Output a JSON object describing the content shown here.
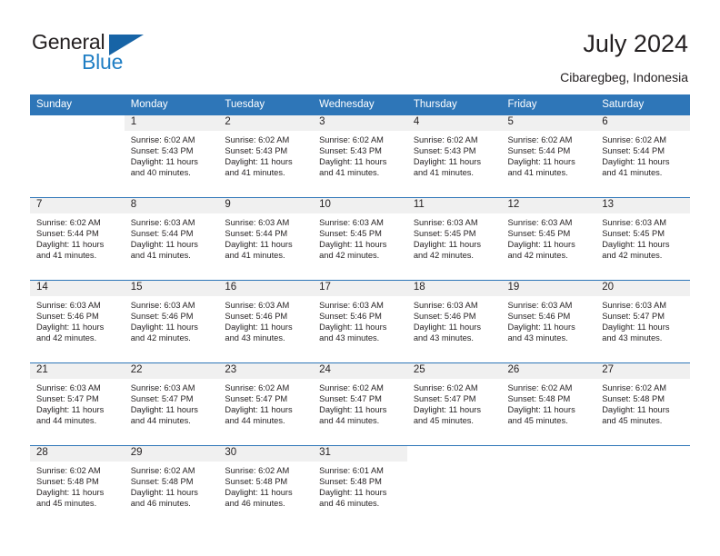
{
  "brand": {
    "name_top": "General",
    "name_bottom": "Blue",
    "accent_color": "#1f7ec4",
    "triangle_color": "#1764a6"
  },
  "header": {
    "title": "July 2024",
    "subtitle": "Cibaregbeg, Indonesia",
    "header_band_color": "#2e76b8",
    "daynum_band_color": "#f0f0f0"
  },
  "calendar": {
    "weekday_headers": [
      "Sunday",
      "Monday",
      "Tuesday",
      "Wednesday",
      "Thursday",
      "Friday",
      "Saturday"
    ],
    "weeks": [
      [
        {
          "day": "",
          "sunrise": "",
          "sunset": "",
          "daylight_line1": "",
          "daylight_line2": ""
        },
        {
          "day": "1",
          "sunrise": "Sunrise: 6:02 AM",
          "sunset": "Sunset: 5:43 PM",
          "daylight_line1": "Daylight: 11 hours",
          "daylight_line2": "and 40 minutes."
        },
        {
          "day": "2",
          "sunrise": "Sunrise: 6:02 AM",
          "sunset": "Sunset: 5:43 PM",
          "daylight_line1": "Daylight: 11 hours",
          "daylight_line2": "and 41 minutes."
        },
        {
          "day": "3",
          "sunrise": "Sunrise: 6:02 AM",
          "sunset": "Sunset: 5:43 PM",
          "daylight_line1": "Daylight: 11 hours",
          "daylight_line2": "and 41 minutes."
        },
        {
          "day": "4",
          "sunrise": "Sunrise: 6:02 AM",
          "sunset": "Sunset: 5:43 PM",
          "daylight_line1": "Daylight: 11 hours",
          "daylight_line2": "and 41 minutes."
        },
        {
          "day": "5",
          "sunrise": "Sunrise: 6:02 AM",
          "sunset": "Sunset: 5:44 PM",
          "daylight_line1": "Daylight: 11 hours",
          "daylight_line2": "and 41 minutes."
        },
        {
          "day": "6",
          "sunrise": "Sunrise: 6:02 AM",
          "sunset": "Sunset: 5:44 PM",
          "daylight_line1": "Daylight: 11 hours",
          "daylight_line2": "and 41 minutes."
        }
      ],
      [
        {
          "day": "7",
          "sunrise": "Sunrise: 6:02 AM",
          "sunset": "Sunset: 5:44 PM",
          "daylight_line1": "Daylight: 11 hours",
          "daylight_line2": "and 41 minutes."
        },
        {
          "day": "8",
          "sunrise": "Sunrise: 6:03 AM",
          "sunset": "Sunset: 5:44 PM",
          "daylight_line1": "Daylight: 11 hours",
          "daylight_line2": "and 41 minutes."
        },
        {
          "day": "9",
          "sunrise": "Sunrise: 6:03 AM",
          "sunset": "Sunset: 5:44 PM",
          "daylight_line1": "Daylight: 11 hours",
          "daylight_line2": "and 41 minutes."
        },
        {
          "day": "10",
          "sunrise": "Sunrise: 6:03 AM",
          "sunset": "Sunset: 5:45 PM",
          "daylight_line1": "Daylight: 11 hours",
          "daylight_line2": "and 42 minutes."
        },
        {
          "day": "11",
          "sunrise": "Sunrise: 6:03 AM",
          "sunset": "Sunset: 5:45 PM",
          "daylight_line1": "Daylight: 11 hours",
          "daylight_line2": "and 42 minutes."
        },
        {
          "day": "12",
          "sunrise": "Sunrise: 6:03 AM",
          "sunset": "Sunset: 5:45 PM",
          "daylight_line1": "Daylight: 11 hours",
          "daylight_line2": "and 42 minutes."
        },
        {
          "day": "13",
          "sunrise": "Sunrise: 6:03 AM",
          "sunset": "Sunset: 5:45 PM",
          "daylight_line1": "Daylight: 11 hours",
          "daylight_line2": "and 42 minutes."
        }
      ],
      [
        {
          "day": "14",
          "sunrise": "Sunrise: 6:03 AM",
          "sunset": "Sunset: 5:46 PM",
          "daylight_line1": "Daylight: 11 hours",
          "daylight_line2": "and 42 minutes."
        },
        {
          "day": "15",
          "sunrise": "Sunrise: 6:03 AM",
          "sunset": "Sunset: 5:46 PM",
          "daylight_line1": "Daylight: 11 hours",
          "daylight_line2": "and 42 minutes."
        },
        {
          "day": "16",
          "sunrise": "Sunrise: 6:03 AM",
          "sunset": "Sunset: 5:46 PM",
          "daylight_line1": "Daylight: 11 hours",
          "daylight_line2": "and 43 minutes."
        },
        {
          "day": "17",
          "sunrise": "Sunrise: 6:03 AM",
          "sunset": "Sunset: 5:46 PM",
          "daylight_line1": "Daylight: 11 hours",
          "daylight_line2": "and 43 minutes."
        },
        {
          "day": "18",
          "sunrise": "Sunrise: 6:03 AM",
          "sunset": "Sunset: 5:46 PM",
          "daylight_line1": "Daylight: 11 hours",
          "daylight_line2": "and 43 minutes."
        },
        {
          "day": "19",
          "sunrise": "Sunrise: 6:03 AM",
          "sunset": "Sunset: 5:46 PM",
          "daylight_line1": "Daylight: 11 hours",
          "daylight_line2": "and 43 minutes."
        },
        {
          "day": "20",
          "sunrise": "Sunrise: 6:03 AM",
          "sunset": "Sunset: 5:47 PM",
          "daylight_line1": "Daylight: 11 hours",
          "daylight_line2": "and 43 minutes."
        }
      ],
      [
        {
          "day": "21",
          "sunrise": "Sunrise: 6:03 AM",
          "sunset": "Sunset: 5:47 PM",
          "daylight_line1": "Daylight: 11 hours",
          "daylight_line2": "and 44 minutes."
        },
        {
          "day": "22",
          "sunrise": "Sunrise: 6:03 AM",
          "sunset": "Sunset: 5:47 PM",
          "daylight_line1": "Daylight: 11 hours",
          "daylight_line2": "and 44 minutes."
        },
        {
          "day": "23",
          "sunrise": "Sunrise: 6:02 AM",
          "sunset": "Sunset: 5:47 PM",
          "daylight_line1": "Daylight: 11 hours",
          "daylight_line2": "and 44 minutes."
        },
        {
          "day": "24",
          "sunrise": "Sunrise: 6:02 AM",
          "sunset": "Sunset: 5:47 PM",
          "daylight_line1": "Daylight: 11 hours",
          "daylight_line2": "and 44 minutes."
        },
        {
          "day": "25",
          "sunrise": "Sunrise: 6:02 AM",
          "sunset": "Sunset: 5:47 PM",
          "daylight_line1": "Daylight: 11 hours",
          "daylight_line2": "and 45 minutes."
        },
        {
          "day": "26",
          "sunrise": "Sunrise: 6:02 AM",
          "sunset": "Sunset: 5:48 PM",
          "daylight_line1": "Daylight: 11 hours",
          "daylight_line2": "and 45 minutes."
        },
        {
          "day": "27",
          "sunrise": "Sunrise: 6:02 AM",
          "sunset": "Sunset: 5:48 PM",
          "daylight_line1": "Daylight: 11 hours",
          "daylight_line2": "and 45 minutes."
        }
      ],
      [
        {
          "day": "28",
          "sunrise": "Sunrise: 6:02 AM",
          "sunset": "Sunset: 5:48 PM",
          "daylight_line1": "Daylight: 11 hours",
          "daylight_line2": "and 45 minutes."
        },
        {
          "day": "29",
          "sunrise": "Sunrise: 6:02 AM",
          "sunset": "Sunset: 5:48 PM",
          "daylight_line1": "Daylight: 11 hours",
          "daylight_line2": "and 46 minutes."
        },
        {
          "day": "30",
          "sunrise": "Sunrise: 6:02 AM",
          "sunset": "Sunset: 5:48 PM",
          "daylight_line1": "Daylight: 11 hours",
          "daylight_line2": "and 46 minutes."
        },
        {
          "day": "31",
          "sunrise": "Sunrise: 6:01 AM",
          "sunset": "Sunset: 5:48 PM",
          "daylight_line1": "Daylight: 11 hours",
          "daylight_line2": "and 46 minutes."
        },
        {
          "day": "",
          "sunrise": "",
          "sunset": "",
          "daylight_line1": "",
          "daylight_line2": ""
        },
        {
          "day": "",
          "sunrise": "",
          "sunset": "",
          "daylight_line1": "",
          "daylight_line2": ""
        },
        {
          "day": "",
          "sunrise": "",
          "sunset": "",
          "daylight_line1": "",
          "daylight_line2": ""
        }
      ]
    ]
  }
}
